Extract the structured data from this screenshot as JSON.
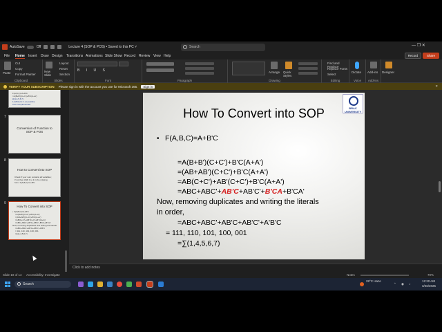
{
  "titlebar": {
    "autosave_label": "AutoSave",
    "autosave_state": "Off",
    "doc_title": "Lecture 4 (SOP & POS) • Saved to this PC ˅",
    "search_placeholder": "Search",
    "controls": "—   ❐   ✕"
  },
  "menu": {
    "tabs": [
      "File",
      "Home",
      "Insert",
      "Draw",
      "Design",
      "Transitions",
      "Animations",
      "Slide Show",
      "Record",
      "Review",
      "View",
      "Help"
    ],
    "active": "Home",
    "record_label": "Record",
    "share_label": "Share"
  },
  "ribbon": {
    "groups": [
      "Clipboard",
      "Slides",
      "Font",
      "Paragraph",
      "Drawing",
      "Editing",
      "Voice",
      "Add-ins"
    ],
    "clipboard_items": [
      "Cut",
      "Copy",
      "Format Painter"
    ],
    "paste_label": "Paste",
    "slides_items": [
      "Layout",
      "Reset",
      "Section"
    ],
    "new_slide_label": "New Slide",
    "editing_items": [
      "Find and Replace",
      "Replace Fonts",
      "Select"
    ],
    "arrange_label": "Arrange",
    "quick_styles_label": "Quick Styles",
    "dictate_label": "Dictate",
    "addins_label": "Add-ins",
    "designer_label": "Designer"
  },
  "notification": {
    "label": "VERIFY YOUR SUBSCRIPTION",
    "message": "Please sign in with the account you use for Microsoft 365.",
    "button": "Sign in"
  },
  "thumbnails": [
    {
      "num": "",
      "title": "",
      "lines": [
        "F(A,B,C)=A+B'C",
        "=A(B+B')(C+C')+B'C(A+A')",
        "Ω(1,4,5,6,7)",
        "1+Minterm: 1 as positive",
        "0 as complemented"
      ]
    },
    {
      "num": "7",
      "title": "Conversion of Function to SOP & POS",
      "lines": []
    },
    {
      "num": "8",
      "title": "How to Convert into SOP",
      "lines": [
        "Check if your sum contains all variables;",
        "if not then AND 1 to it in the missing",
        "form. F(A,B,C)=A+B'C"
      ]
    },
    {
      "num": "9",
      "title": "How To Convert into SOP",
      "lines": [
        "• F(A,B,C)=A+B'C",
        "=A(B+B')(C+C')+B'C(A+A')",
        "=(AB+AB')(C+C')+B'C(A+A')",
        "=AB(C+C')+AB'(C+C')+B'C(A+A')",
        "=ABC+ABC'+AB'C+AB'C'+B'CA+B'CA'",
        "Now, removing duplicates and writing the literals",
        "=ABC+ABC'+AB'C+AB'C'+A'B'C",
        "= 111, 110, 101, 100, 001",
        "=∑(1,4,5,6,7)"
      ]
    }
  ],
  "slide": {
    "title": "How To Convert into SOP",
    "logo_text": "BRAC UNIVERSITY",
    "bullet": "•",
    "lines": [
      "F(A,B,C)=A+B'C",
      "=A(B+B')(C+C')+B'C(A+A')",
      "=(AB+AB')(C+C')+B'C(A+A')",
      "=AB(C+C')+AB'(C+C')+B'C(A+A')",
      "Now, removing duplicates and writing the literals",
      "in order,",
      "=ABC+ABC'+AB'C+AB'C'+A'B'C",
      "= 111, 110, 101, 100, 001",
      "=∑(1,4,5,6,7)"
    ],
    "line5_parts": [
      "=ABC+ABC'+",
      "AB'C",
      "+AB'C'+",
      "B'CA",
      "+B'CA'"
    ]
  },
  "notes": {
    "placeholder": "Click to add notes"
  },
  "status": {
    "slide_info": "Slide 10 of 14",
    "accessibility": "Accessibility: Investigate",
    "notes_label": "Notes",
    "zoom": "70%"
  },
  "taskbar": {
    "search_placeholder": "Search",
    "weather": "28°C Haze",
    "time": "12:20 AM",
    "date": "3/26/2025"
  },
  "colors": {
    "accent": "#c43e1c",
    "emphasis_red": "#d42020",
    "taskbar": "#1c2434"
  }
}
